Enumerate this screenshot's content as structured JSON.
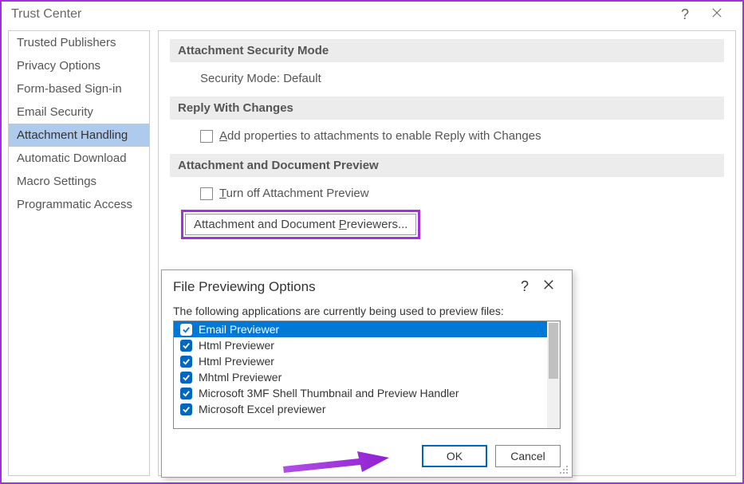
{
  "window": {
    "title": "Trust Center"
  },
  "sidebar": {
    "items": [
      {
        "label": "Trusted Publishers"
      },
      {
        "label": "Privacy Options"
      },
      {
        "label": "Form-based Sign-in"
      },
      {
        "label": "Email Security"
      },
      {
        "label": "Attachment Handling"
      },
      {
        "label": "Automatic Download"
      },
      {
        "label": "Macro Settings"
      },
      {
        "label": "Programmatic Access"
      }
    ],
    "selected_index": 4
  },
  "sections": {
    "security_mode": {
      "header": "Attachment Security Mode",
      "body": "Security Mode: Default"
    },
    "reply_changes": {
      "header": "Reply With Changes",
      "checkbox_label": "Add properties to attachments to enable Reply with Changes"
    },
    "preview": {
      "header": "Attachment and Document Preview",
      "turnoff_label": "Turn off Attachment Preview",
      "previewers_button": "Attachment and Document Previewers..."
    }
  },
  "modal": {
    "title": "File Previewing Options",
    "description": "The following applications are currently being used to preview files:",
    "items": [
      {
        "label": "Email Previewer",
        "checked": true,
        "selected": true
      },
      {
        "label": "Html Previewer",
        "checked": true,
        "selected": false
      },
      {
        "label": "Html Previewer",
        "checked": true,
        "selected": false
      },
      {
        "label": "Mhtml Previewer",
        "checked": true,
        "selected": false
      },
      {
        "label": "Microsoft 3MF Shell Thumbnail and Preview Handler",
        "checked": true,
        "selected": false
      },
      {
        "label": "Microsoft Excel previewer",
        "checked": true,
        "selected": false
      }
    ],
    "ok": "OK",
    "cancel": "Cancel"
  }
}
